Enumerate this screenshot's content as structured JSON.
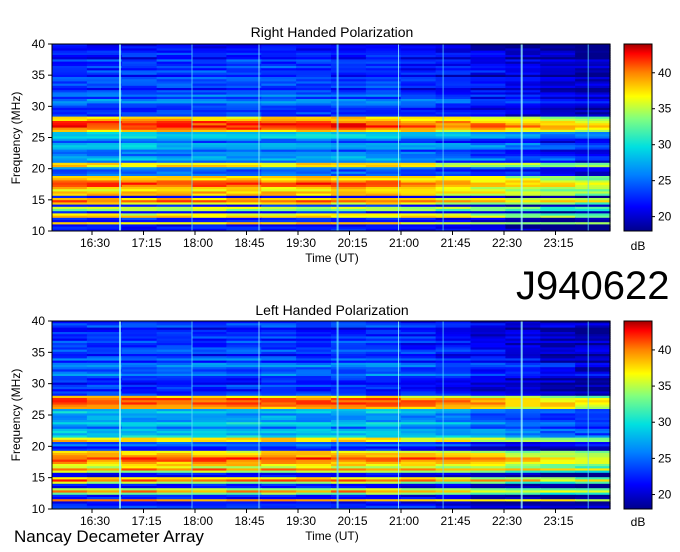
{
  "observation_id": "J940622",
  "instrument_label": "Nancay Decameter Array",
  "chart_data": [
    {
      "type": "heatmap",
      "title": "Right Handed Polarization",
      "xlabel": "Time (UT)",
      "ylabel": "Frequency (MHz)",
      "x_ticks": [
        "16:30",
        "17:15",
        "18:00",
        "18:45",
        "19:30",
        "20:15",
        "21:00",
        "21:45",
        "22:30",
        "23:15"
      ],
      "y_ticks": [
        10,
        15,
        20,
        25,
        30,
        35,
        40
      ],
      "ylim": [
        10,
        40
      ],
      "colorbar": {
        "unit": "dB",
        "range": [
          18,
          44
        ],
        "ticks": [
          20,
          25,
          30,
          35,
          40
        ]
      },
      "bright_bands_mhz": [
        {
          "center": 27.0,
          "width": 2.4,
          "level": 43
        },
        {
          "center": 20.6,
          "width": 0.8,
          "level": 40
        },
        {
          "center": 17.6,
          "width": 2.6,
          "level": 42
        },
        {
          "center": 16.0,
          "width": 1.0,
          "level": 40
        },
        {
          "center": 14.8,
          "width": 1.0,
          "level": 41
        },
        {
          "center": 13.6,
          "width": 0.7,
          "level": 38
        },
        {
          "center": 12.4,
          "width": 0.8,
          "level": 40
        },
        {
          "center": 11.2,
          "width": 0.6,
          "level": 39
        }
      ]
    },
    {
      "type": "heatmap",
      "title": "Left Handed Polarization",
      "xlabel": "Time (UT)",
      "ylabel": "Frequency (MHz)",
      "x_ticks": [
        "16:30",
        "17:15",
        "18:00",
        "18:45",
        "19:30",
        "20:15",
        "21:00",
        "21:45",
        "22:30",
        "23:15"
      ],
      "y_ticks": [
        10,
        15,
        20,
        25,
        30,
        35,
        40
      ],
      "ylim": [
        10,
        40
      ],
      "colorbar": {
        "unit": "dB",
        "range": [
          18,
          44
        ],
        "ticks": [
          20,
          25,
          30,
          35,
          40
        ]
      },
      "bright_bands_mhz": [
        {
          "center": 27.0,
          "width": 2.2,
          "level": 43
        },
        {
          "center": 21.0,
          "width": 0.8,
          "level": 40
        },
        {
          "center": 18.0,
          "width": 2.4,
          "level": 42
        },
        {
          "center": 16.3,
          "width": 1.0,
          "level": 40
        },
        {
          "center": 14.6,
          "width": 0.9,
          "level": 41
        },
        {
          "center": 12.8,
          "width": 0.8,
          "level": 40
        },
        {
          "center": 11.4,
          "width": 0.6,
          "level": 39
        }
      ]
    }
  ]
}
